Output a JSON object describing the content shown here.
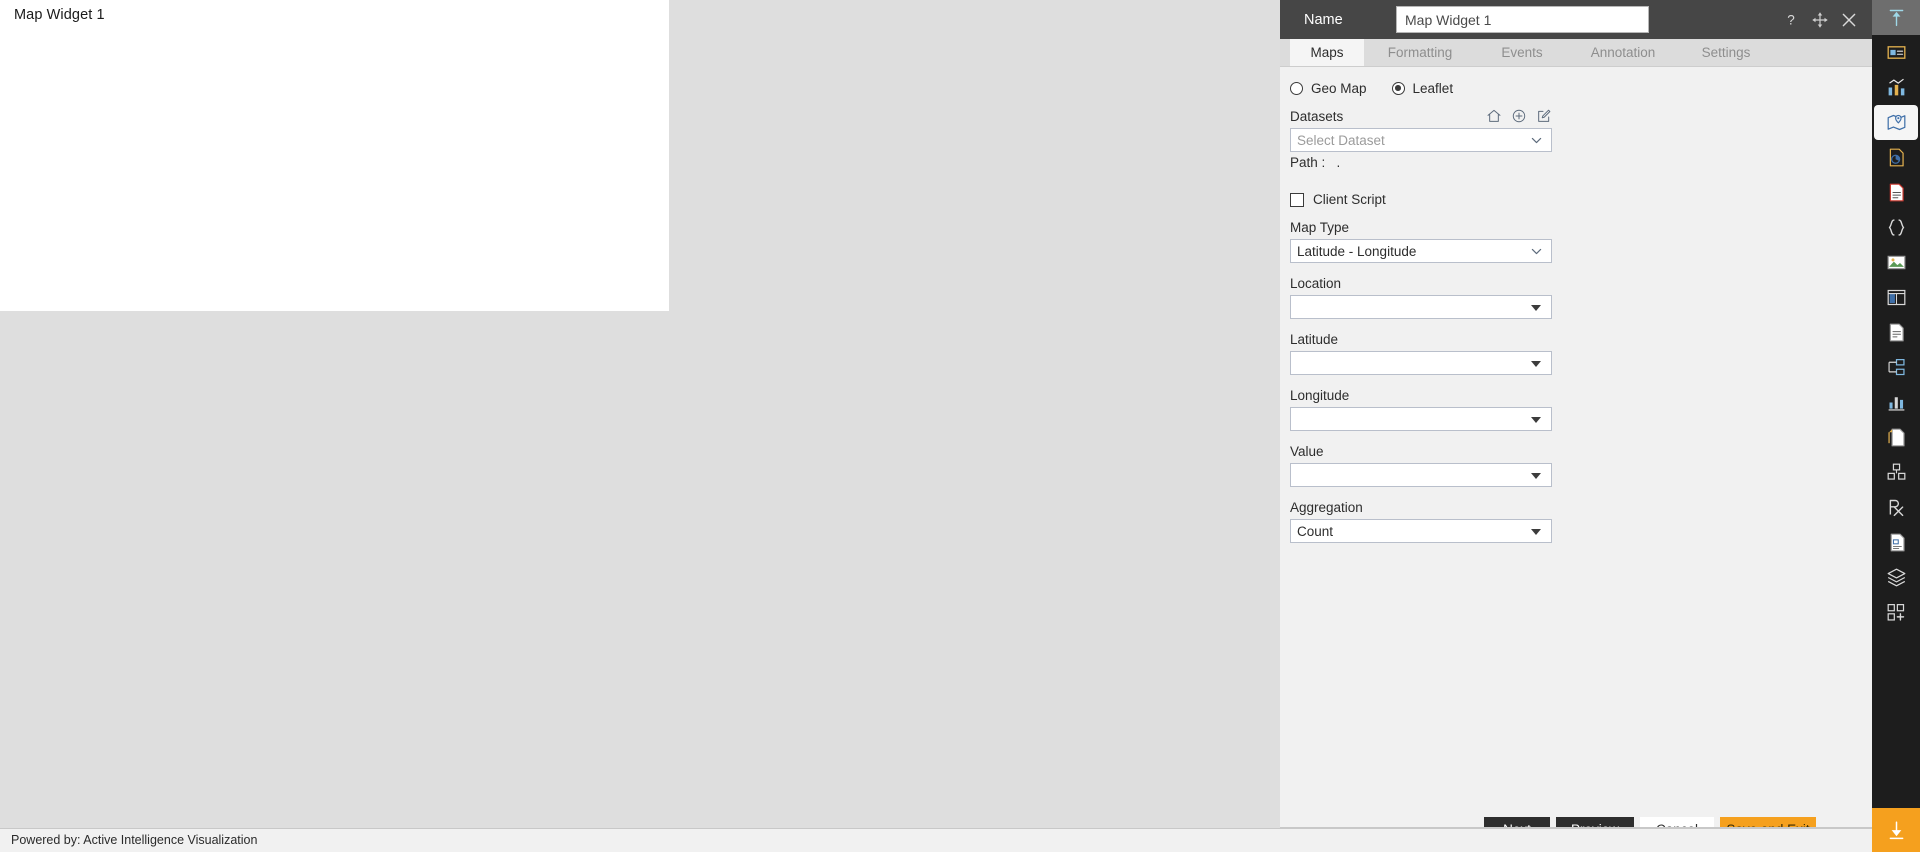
{
  "canvas": {
    "widget_title": "Map Widget 1",
    "footer_text": "Powered by: Active Intelligence Visualization",
    "background_color": "#dedede",
    "widget_background": "#ffffff"
  },
  "panel": {
    "header": {
      "name_label": "Name",
      "name_value": "Map Widget 1",
      "icons": [
        "help-icon",
        "move-icon",
        "close-icon"
      ],
      "background_color": "#464646"
    },
    "tabs": [
      {
        "label": "Maps",
        "active": true
      },
      {
        "label": "Formatting",
        "active": false
      },
      {
        "label": "Events",
        "active": false
      },
      {
        "label": "Annotation",
        "active": false
      },
      {
        "label": "Settings",
        "active": false
      }
    ],
    "map_source": {
      "options": [
        {
          "label": "Geo Map",
          "selected": false
        },
        {
          "label": "Leaflet",
          "selected": true
        }
      ]
    },
    "datasets": {
      "label": "Datasets",
      "icons": [
        "home-icon",
        "add-circle-icon",
        "edit-icon"
      ],
      "select_placeholder": "Select Dataset",
      "select_value": "",
      "path_label": "Path :",
      "path_value": "."
    },
    "client_script": {
      "label": "Client Script",
      "checked": false
    },
    "fields": [
      {
        "label": "Map Type",
        "value": "Latitude - Longitude",
        "style": "chevron"
      },
      {
        "label": "Location",
        "value": "",
        "style": "caret"
      },
      {
        "label": "Latitude",
        "value": "",
        "style": "caret"
      },
      {
        "label": "Longitude",
        "value": "",
        "style": "caret"
      },
      {
        "label": "Value",
        "value": "",
        "style": "caret"
      },
      {
        "label": "Aggregation",
        "value": "Count",
        "style": "caret"
      }
    ],
    "buttons": [
      {
        "label": "Next",
        "kind": "dark"
      },
      {
        "label": "Preview",
        "kind": "dark"
      },
      {
        "label": "Cancel",
        "kind": "light"
      },
      {
        "label": "Save and Exit",
        "kind": "accent"
      }
    ],
    "accent_color": "#f5a01e"
  },
  "rail": {
    "items": [
      {
        "name": "collapse-up-icon",
        "state": "header"
      },
      {
        "name": "card-widget-icon",
        "state": "normal"
      },
      {
        "name": "chart-widget-icon",
        "state": "normal"
      },
      {
        "name": "map-widget-icon",
        "state": "selected"
      },
      {
        "name": "report-pie-icon",
        "state": "normal"
      },
      {
        "name": "document-icon",
        "state": "normal"
      },
      {
        "name": "code-braces-icon",
        "state": "normal"
      },
      {
        "name": "image-icon",
        "state": "normal"
      },
      {
        "name": "table-layout-icon",
        "state": "normal"
      },
      {
        "name": "text-page-icon",
        "state": "normal"
      },
      {
        "name": "tree-hierarchy-icon",
        "state": "normal"
      },
      {
        "name": "bar-chart-icon",
        "state": "normal"
      },
      {
        "name": "copy-page-icon",
        "state": "normal"
      },
      {
        "name": "blocks-icon",
        "state": "normal"
      },
      {
        "name": "prescription-icon",
        "state": "normal"
      },
      {
        "name": "form-page-icon",
        "state": "normal"
      },
      {
        "name": "layers-icon",
        "state": "normal"
      },
      {
        "name": "add-grid-icon",
        "state": "normal"
      },
      {
        "name": "download-icon",
        "state": "accent"
      }
    ]
  }
}
